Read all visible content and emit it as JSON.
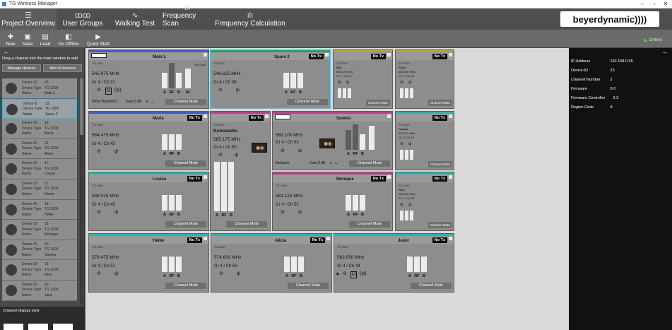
{
  "window": {
    "title": "TG Wireless Manager"
  },
  "nav": {
    "tabs": [
      {
        "label": "Project Overview",
        "icon": "grid-icon"
      },
      {
        "label": "User Groups",
        "icon": "users-icon"
      },
      {
        "label": "Walking Test",
        "icon": "wave-icon"
      },
      {
        "label": "Frequency Scan",
        "icon": "bars-icon"
      },
      {
        "label": "Frequency Calculation",
        "icon": "bars-calc-icon"
      }
    ],
    "brand": "beyerdynamic))))"
  },
  "toolbar": {
    "buttons": [
      {
        "label": "New",
        "icon": "new-icon"
      },
      {
        "label": "Save",
        "icon": "save-icon"
      },
      {
        "label": "Load",
        "icon": "load-icon"
      },
      {
        "label": "Go Offline",
        "icon": "offline-icon"
      },
      {
        "label": "Quick Start",
        "icon": "play-icon"
      }
    ],
    "online": "Online"
  },
  "left_panel": {
    "hint": "Drag a channel into the main window to add",
    "manage_devices": "Manage devices",
    "add_all_devices": "Add all devices",
    "keys": {
      "id": "Device ID",
      "type": "Device Type",
      "name": "Name"
    },
    "devices": [
      {
        "id": "23",
        "type": "TG 1000",
        "name": "Main L"
      },
      {
        "id": "23",
        "type": "TG 1000",
        "name": "Spare 2"
      },
      {
        "id": "16",
        "type": "TG 1000",
        "name": "Maria"
      },
      {
        "id": "16",
        "type": "TG 1000",
        "name": "Alicia"
      },
      {
        "id": "17",
        "type": "TG 1000",
        "name": "Louisa"
      },
      {
        "id": "17",
        "type": "TG 1000",
        "name": "Nicole"
      },
      {
        "id": "18",
        "type": "TG 1000",
        "name": "Heike"
      },
      {
        "id": "18",
        "type": "TG 1000",
        "name": "Monique"
      },
      {
        "id": "19",
        "type": "TG 1000",
        "name": "Sandra"
      },
      {
        "id": "19",
        "type": "TG 1000",
        "name": "Reni"
      },
      {
        "id": "20",
        "type": "TG 1000",
        "name": "Jana"
      }
    ],
    "channel_display_style": "Channel display style"
  },
  "common": {
    "no_tx": "No Tx",
    "channel_mute": "Channel Mute",
    "device_type": "TG 1000"
  },
  "cards": {
    "mainl": {
      "name": "Main L",
      "ch": "Rx Ch42",
      "freq": "545.975 MHz",
      "grp": "Gr 4 / Ch 37",
      "handheld": "990w Handheld",
      "gain": "Gain 6 dB",
      "labels": [
        "A",
        "RF",
        "B",
        "AF"
      ]
    },
    "spare2": {
      "name": "Spare 2",
      "freq": "548.625 MHz",
      "grp": "Gr 4 / Ch 38",
      "labels": [
        "A",
        "RF",
        "B"
      ]
    },
    "nils": {
      "name": "Nils",
      "freq": "585.175 MHz",
      "grp": "Gr 4 / Ch 57"
    },
    "silvia": {
      "name": "Silvia",
      "freq": "554.350 MHz",
      "grp": "Gr 4 / Ch 55"
    },
    "maria": {
      "name": "Maria",
      "freq": "564.475 MHz",
      "grp": "Gr 4 / Ch 45",
      "labels": [
        "A",
        "RF",
        "B"
      ]
    },
    "konstantin": {
      "name": "Konstantin",
      "freq": "585.175 MHz",
      "grp": "Gr 4 / Ch 55"
    },
    "sandra": {
      "name": "Sandra",
      "freq": "582.100 MHz",
      "grp": "Gr 4 / Ch 53",
      "beltpack": "Beltpack",
      "gain": "Gain 0 dB",
      "labels": [
        "A",
        "RF",
        "B"
      ]
    },
    "caspar": {
      "name": "Caspar",
      "freq": "526.475 MHz",
      "grp": "Gr 4 / Ch 45"
    },
    "louisa": {
      "name": "Louisa",
      "freq": "538.025 MHz",
      "grp": "Gr 4 / Ch 45",
      "labels": [
        "A",
        "RF",
        "B"
      ]
    },
    "monique": {
      "name": "Monique",
      "freq": "581.125 MHz",
      "grp": "Gr 4 / Ch 52",
      "labels": [
        "A",
        "RF",
        "B"
      ]
    },
    "reni": {
      "name": "Reni",
      "freq": "588.500 MHz",
      "grp": "Gr 4 / Ch 53"
    },
    "heike": {
      "name": "Heike",
      "freq": "578.475 MHz",
      "grp": "Gr 4 / Ch 51",
      "labels": [
        "A",
        "RF",
        "B"
      ]
    },
    "alicia": {
      "name": "Alicia",
      "freq": "574.600 MHz",
      "grp": "Gr 4 / Ch 50",
      "labels": [
        "A",
        "RF",
        "B"
      ]
    },
    "janet": {
      "name": "Janet",
      "freq": "562.050 MHz",
      "grp": "Gr 4 / Ch 44",
      "labels": [
        "A",
        "RF",
        "B"
      ]
    }
  },
  "right_panel": {
    "rows": [
      {
        "k": "IP-Address",
        "v": "192.168.0.55"
      },
      {
        "k": "Device-ID",
        "v": "23"
      },
      {
        "k": "Channel Number",
        "v": "2"
      },
      {
        "k": "Firmware",
        "v": "0.0"
      },
      {
        "k": "Firmware Controller",
        "v": "2.3"
      },
      {
        "k": "Region Code",
        "v": "A"
      }
    ]
  },
  "colors": {
    "accent_blue": "#3e5ec6",
    "accent_green": "#27a35c",
    "accent_olive": "#b3a33a",
    "accent_magenta": "#c23d8f",
    "accent_cyan": "#2fb3b0",
    "selection": "#4ec9e4"
  }
}
